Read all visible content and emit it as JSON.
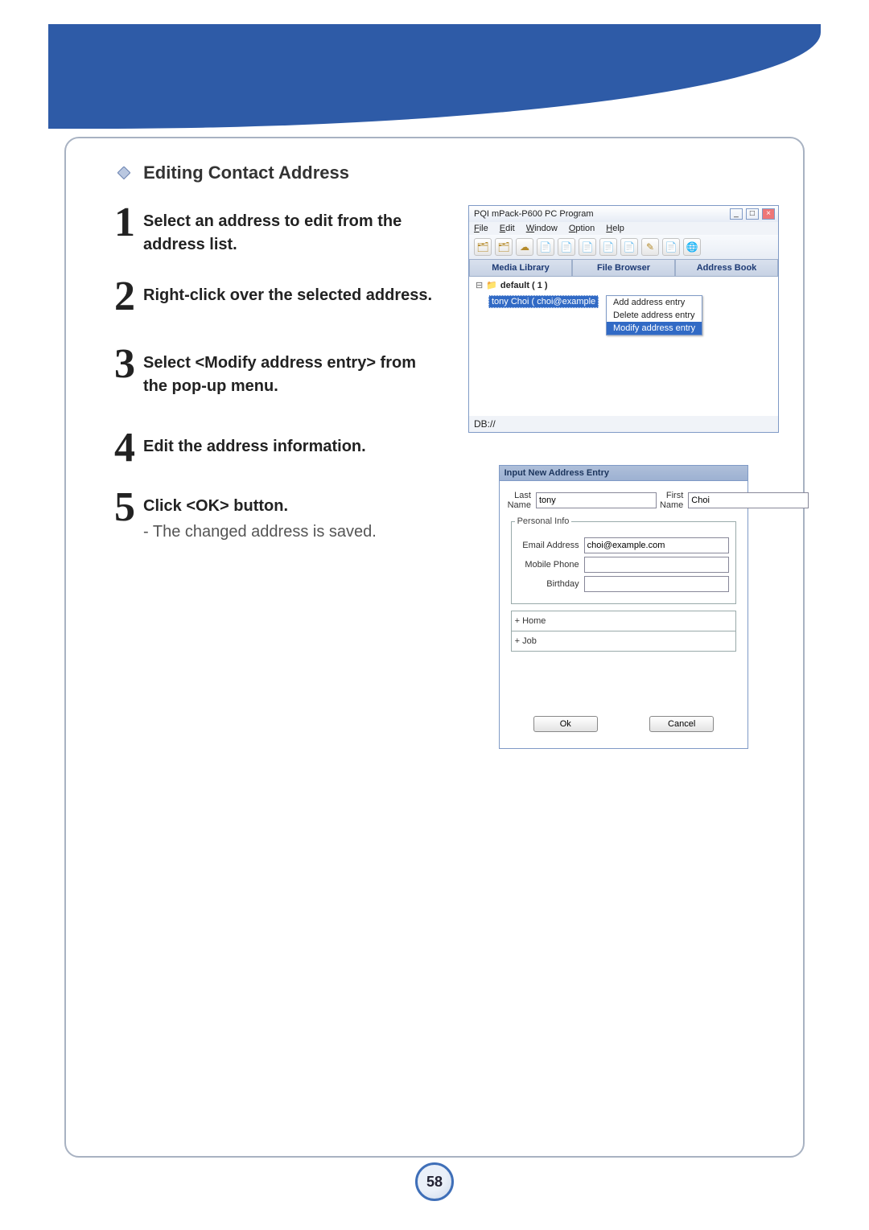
{
  "page_number": "58",
  "section_title": "Editing Contact Address",
  "steps": [
    {
      "num": "1",
      "text": "Select an address to edit from the address list."
    },
    {
      "num": "2",
      "text": "Right-click over the selected address."
    },
    {
      "num": "3",
      "text": "Select <Modify address entry> from the pop-up menu."
    },
    {
      "num": "4",
      "text": "Edit the address information."
    },
    {
      "num": "5",
      "text": "Click <OK> button.",
      "note": "- The changed address is saved."
    }
  ],
  "screenshot1": {
    "window_title": "PQI mPack-P600 PC Program",
    "menu": [
      "File",
      "Edit",
      "Window",
      "Option",
      "Help"
    ],
    "tabs": [
      "Media Library",
      "File Browser",
      "Address Book"
    ],
    "tree_root": "default ( 1 )",
    "selected_entry": "tony Choi ( choi@example",
    "context_menu": [
      "Add address entry",
      "Delete address entry",
      "Modify address entry"
    ],
    "status_bar": "DB://"
  },
  "screenshot2": {
    "dialog_title": "Input New Address Entry",
    "last_name_label": "Last Name",
    "last_name_value": "tony",
    "first_name_label": "First Name",
    "first_name_value": "Choi",
    "personal_legend": "Personal Info",
    "email_label": "Email Address",
    "email_value": "choi@example.com",
    "mobile_label": "Mobile Phone",
    "mobile_value": "",
    "birthday_label": "Birthday",
    "birthday_value": "",
    "home_section": "+ Home",
    "job_section": "+ Job",
    "ok_label": "Ok",
    "cancel_label": "Cancel"
  }
}
